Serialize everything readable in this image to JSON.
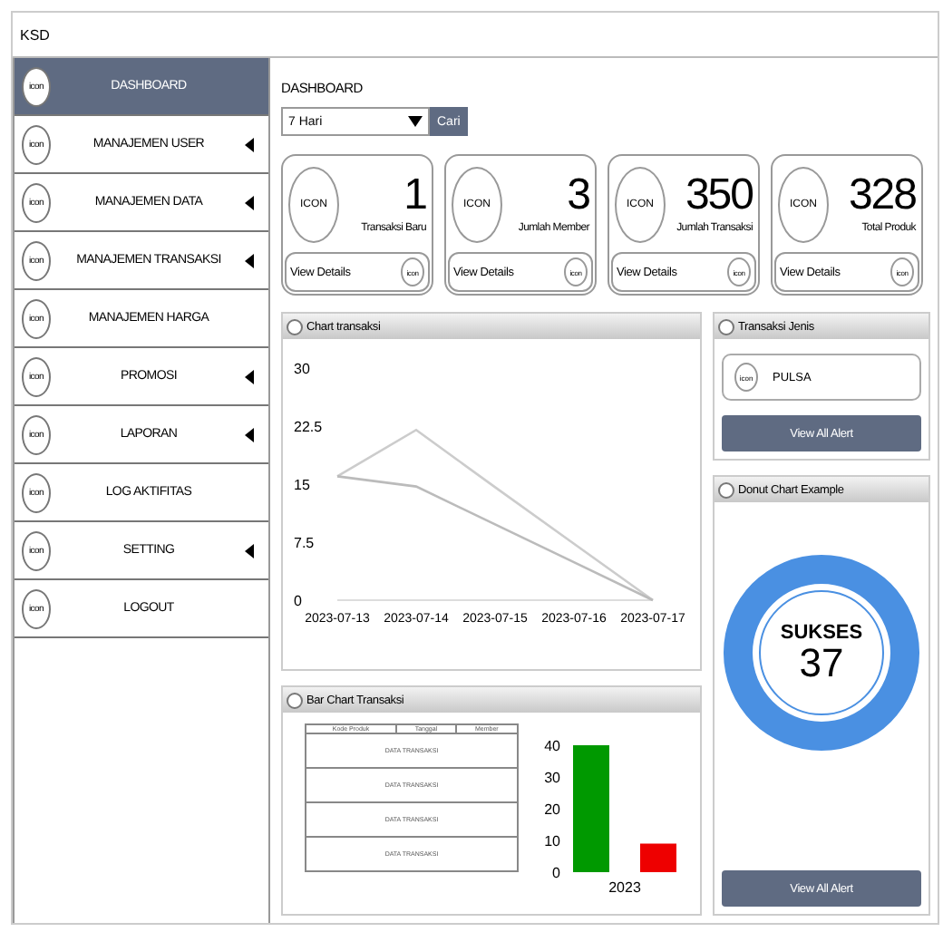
{
  "window": {
    "title": "KSD"
  },
  "sidebar": {
    "items": [
      {
        "label": "DASHBOARD",
        "icon_text": "icon",
        "selected": true,
        "has_submenu": false
      },
      {
        "label": "MANAJEMEN USER",
        "icon_text": "icon",
        "selected": false,
        "has_submenu": true
      },
      {
        "label": "MANAJEMEN DATA",
        "icon_text": "icon",
        "selected": false,
        "has_submenu": true
      },
      {
        "label": "MANAJEMEN TRANSAKSI",
        "icon_text": "icon",
        "selected": false,
        "has_submenu": true
      },
      {
        "label": "MANAJEMEN HARGA",
        "icon_text": "icon",
        "selected": false,
        "has_submenu": false
      },
      {
        "label": "PROMOSI",
        "icon_text": "icon",
        "selected": false,
        "has_submenu": true
      },
      {
        "label": "LAPORAN",
        "icon_text": "icon",
        "selected": false,
        "has_submenu": true
      },
      {
        "label": "LOG AKTIFITAS",
        "icon_text": "icon",
        "selected": false,
        "has_submenu": false
      },
      {
        "label": "SETTING",
        "icon_text": "icon",
        "selected": false,
        "has_submenu": true
      },
      {
        "label": "LOGOUT",
        "icon_text": "icon",
        "selected": false,
        "has_submenu": false
      }
    ]
  },
  "page_title": "DASHBOARD",
  "filter": {
    "value": "7 Hari",
    "button": "Cari"
  },
  "stat_cards": [
    {
      "icon_text": "ICON",
      "value": "1",
      "label": "Transaksi Baru",
      "link": "View Details",
      "link_icon_text": "icon"
    },
    {
      "icon_text": "ICON",
      "value": "3",
      "label": "Jumlah Member",
      "link": "View Details",
      "link_icon_text": "icon"
    },
    {
      "icon_text": "ICON",
      "value": "350",
      "label": "Jumlah Transaksi",
      "link": "View Details",
      "link_icon_text": "icon"
    },
    {
      "icon_text": "ICON",
      "value": "328",
      "label": "Total Produk",
      "link": "View Details",
      "link_icon_text": "icon"
    }
  ],
  "line_panel": {
    "title": "Chart transaksi",
    "chart_data": {
      "type": "line",
      "categories": [
        "2023-07-13",
        "2023-07-14",
        "2023-07-15",
        "2023-07-16",
        "2023-07-17"
      ],
      "ylim": [
        0,
        30
      ],
      "yticks": [
        0,
        7.5,
        15,
        22.5,
        30
      ],
      "series": [
        {
          "color": "#cccccc",
          "values": [
            16,
            22,
            14.6,
            7.3,
            0
          ]
        },
        {
          "color": "#bbbbbb",
          "values": [
            16,
            14.7,
            9.8,
            4.9,
            0
          ]
        }
      ]
    }
  },
  "jenis_panel": {
    "title": "Transaksi Jenis",
    "items": [
      {
        "icon_text": "icon",
        "label": "PULSA"
      }
    ],
    "button": "View All Alert"
  },
  "donut_panel": {
    "title": "Donut Chart Example",
    "ring": {
      "label": "SUKSES",
      "value": "37"
    },
    "button": "View All Alert"
  },
  "bar_panel": {
    "title": "Bar Chart Transaksi",
    "table": {
      "columns": [
        "Kode Produk",
        "Tanggal",
        "Member"
      ],
      "rows": [
        "DATA TRANSAKSI",
        "DATA TRANSAKSI",
        "DATA TRANSAKSI",
        "DATA TRANSAKSI"
      ]
    },
    "chart_data": {
      "type": "bar",
      "categories": [
        "2023"
      ],
      "ylim": [
        0,
        40
      ],
      "yticks": [
        0,
        10,
        20,
        30,
        40
      ],
      "series": [
        {
          "color": "#009900",
          "values": [
            40
          ]
        },
        {
          "color": "#ee0000",
          "values": [
            9
          ]
        }
      ]
    }
  }
}
